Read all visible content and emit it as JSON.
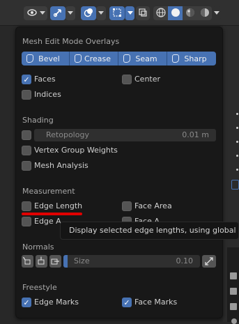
{
  "panel": {
    "title": "Mesh Edit Mode Overlays",
    "toggles": [
      {
        "label": "Bevel"
      },
      {
        "label": "Crease"
      },
      {
        "label": "Seam"
      },
      {
        "label": "Sharp"
      }
    ],
    "faces": {
      "label": "Faces",
      "checked": true
    },
    "center": {
      "label": "Center",
      "checked": false
    },
    "indices": {
      "label": "Indices",
      "checked": false
    },
    "shading": {
      "title": "Shading",
      "retopology": {
        "label": "Retopology",
        "value": "0.01 m",
        "checked": false
      },
      "vertex_group_weights": {
        "label": "Vertex Group Weights",
        "checked": false
      },
      "mesh_analysis": {
        "label": "Mesh Analysis",
        "checked": false
      }
    },
    "measurement": {
      "title": "Measurement",
      "edge_length": {
        "label": "Edge Length",
        "checked": false
      },
      "face_area": {
        "label": "Face Area",
        "checked": false
      },
      "edge_angle": {
        "label": "Edge A",
        "checked": false
      },
      "face_angle": {
        "label": "Face A",
        "checked": false
      }
    },
    "normals": {
      "title": "Normals",
      "size_label": "Size",
      "size_value": "0.10"
    },
    "freestyle": {
      "title": "Freestyle",
      "edge_marks": {
        "label": "Edge Marks",
        "checked": true
      },
      "face_marks": {
        "label": "Face Marks",
        "checked": true
      }
    }
  },
  "tooltip": {
    "text": "Display selected edge lengths, using global va"
  },
  "colors": {
    "accent": "#4772b3",
    "panel_bg": "#181818",
    "highlight_line": "#e10000"
  }
}
